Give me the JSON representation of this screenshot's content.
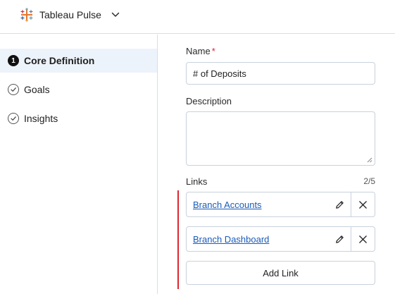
{
  "header": {
    "app_name": "Tableau Pulse",
    "logo_icon": "tableau-plus-logo",
    "menu_icon": "chevron-down-icon"
  },
  "sidebar": {
    "items": [
      {
        "label": "Core Definition",
        "marker": "1",
        "state": "active"
      },
      {
        "label": "Goals",
        "marker": "check-circle-icon",
        "state": "completed"
      },
      {
        "label": "Insights",
        "marker": "check-circle-icon",
        "state": "completed"
      }
    ]
  },
  "form": {
    "name_label": "Name",
    "required_marker": "*",
    "name_value": "# of Deposits",
    "description_label": "Description",
    "description_value": "",
    "links_label": "Links",
    "links_count": "2/5",
    "links": [
      {
        "label": "Branch Accounts",
        "edit_icon": "pencil-icon",
        "remove_icon": "close-icon"
      },
      {
        "label": "Branch Dashboard",
        "edit_icon": "pencil-icon",
        "remove_icon": "close-icon"
      }
    ],
    "add_link_label": "Add Link"
  },
  "colors": {
    "active_nav_bg": "#edf3fb",
    "link_text": "#1a5bb8",
    "required": "#d7263d",
    "validation_rule": "#e0242e"
  }
}
